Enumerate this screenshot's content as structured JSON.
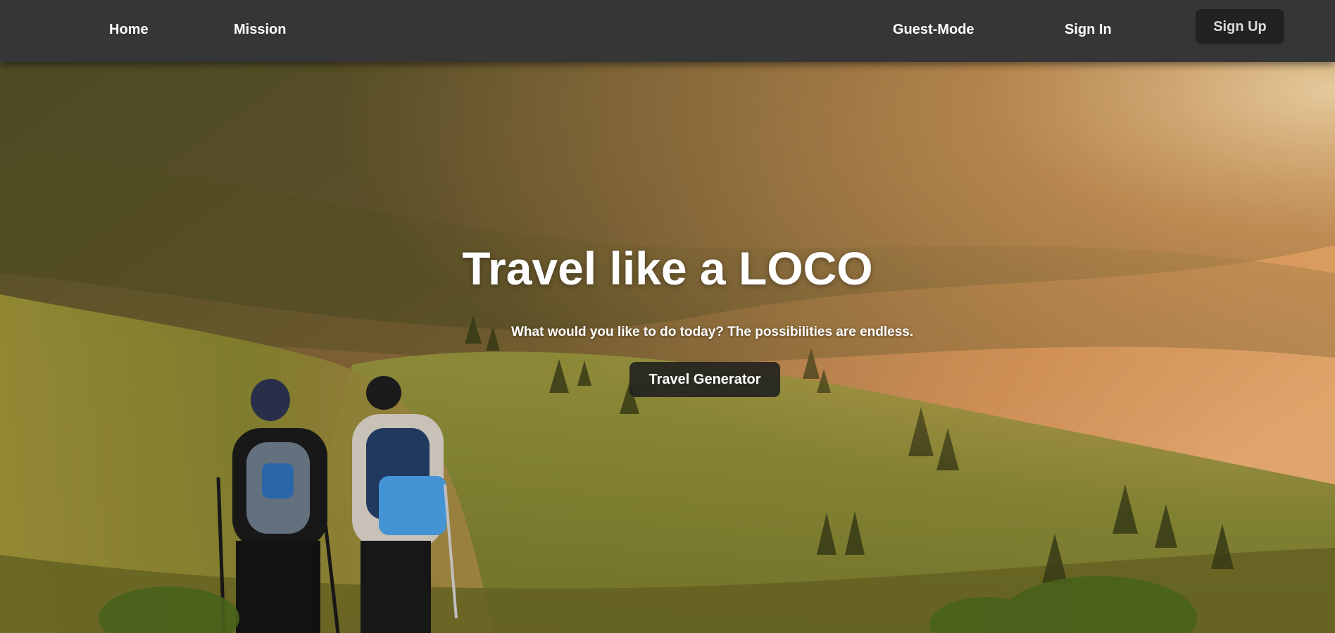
{
  "nav": {
    "home": "Home",
    "mission": "Mission",
    "guest_mode": "Guest-Mode",
    "sign_in": "Sign In",
    "sign_up": "Sign Up"
  },
  "hero": {
    "title": "Travel like a LOCO",
    "subtitle": "What would you like to do today? The possibilities are endless.",
    "cta_label": "Travel Generator",
    "background_image": "hikers-mountain-valley-sunset"
  },
  "colors": {
    "navbar_bg": "#363636",
    "signup_bg": "#222222",
    "cta_bg": "#1e1e1e",
    "text": "#ffffff"
  }
}
